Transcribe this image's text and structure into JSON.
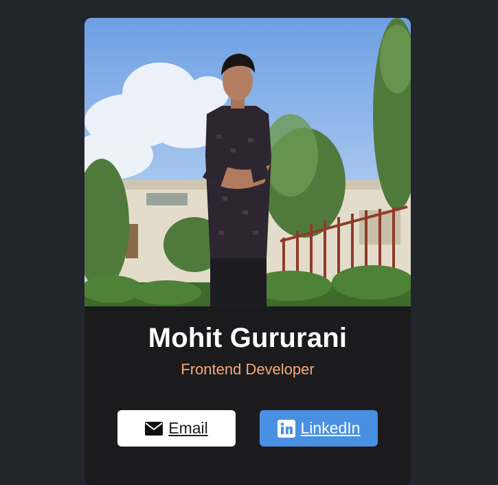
{
  "profile": {
    "name": "Mohit Gururani",
    "role": "Frontend Developer"
  },
  "buttons": {
    "email_label": "Email",
    "email_icon": "envelope-icon",
    "linkedin_label": "LinkedIn",
    "linkedin_icon": "linkedin-icon"
  },
  "colors": {
    "page_background": "#23252c",
    "card_background": "#1b1b1d",
    "role_accent": "#f5a97a",
    "linkedin_blue": "#4a90e2"
  }
}
